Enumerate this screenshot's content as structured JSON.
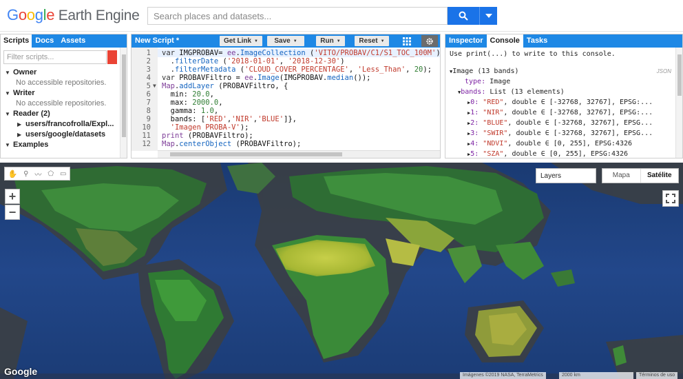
{
  "header": {
    "logo_parts": [
      "G",
      "o",
      "o",
      "g",
      "l",
      "e"
    ],
    "logo_rest": " Earth Engine",
    "search_placeholder": "Search places and datasets..."
  },
  "left_panel": {
    "tabs": [
      "Scripts",
      "Docs",
      "Assets"
    ],
    "filter_placeholder": "Filter scripts...",
    "tree": {
      "owner": "Owner",
      "owner_note": "No accessible repositories.",
      "writer": "Writer",
      "writer_note": "No accessible repositories.",
      "reader": "Reader (2)",
      "reader_items": [
        "users/francofrolla/Expl...",
        "users/google/datasets"
      ],
      "examples": "Examples"
    }
  },
  "editor": {
    "title": "New Script *",
    "buttons": {
      "get_link": "Get Link",
      "save": "Save",
      "run": "Run",
      "reset": "Reset"
    },
    "line_numbers": [
      "1",
      "2",
      "3",
      "4",
      "5",
      "6",
      "7",
      "8",
      "9",
      "10",
      "11",
      "12"
    ]
  },
  "right_panel": {
    "tabs": [
      "Inspector",
      "Console",
      "Tasks"
    ],
    "hint": "Use print(...) to write to this console.",
    "image_header": "Image (13 bands)",
    "json_label": "JSON",
    "type_key": "type:",
    "type_val": "Image",
    "bands_key": "bands:",
    "bands_val": "List (13 elements)",
    "bands": [
      {
        "idx": "0:",
        "name": "\"RED\"",
        "desc": ", double ∈ [-32768, 32767], EPSG:..."
      },
      {
        "idx": "1:",
        "name": "\"NIR\"",
        "desc": ", double ∈ [-32768, 32767], EPSG:..."
      },
      {
        "idx": "2:",
        "name": "\"BLUE\"",
        "desc": ", double ∈ [-32768, 32767], EPSG..."
      },
      {
        "idx": "3:",
        "name": "\"SWIR\"",
        "desc": ", double ∈ [-32768, 32767], EPSG..."
      },
      {
        "idx": "4:",
        "name": "\"NDVI\"",
        "desc": ", double ∈ [0, 255], EPSG:4326"
      },
      {
        "idx": "5:",
        "name": "\"SZA\"",
        "desc": ", double ∈ [0, 255], EPSG:4326"
      }
    ]
  },
  "map": {
    "zoom_in": "+",
    "zoom_out": "−",
    "layers": "Layers",
    "map_types": [
      "Mapa",
      "Satélite"
    ],
    "google_mark": "Google",
    "attribution": "Imágenes ©2019 NASA, TerraMetrics",
    "scale": "2000 km",
    "terms": "Términos de uso"
  },
  "colors": {
    "brand_blue": "#1e88e5",
    "search_blue": "#1a73e8",
    "ocean": "#1d3f78",
    "vegetation": "#3f9a3a",
    "desert": "#a8b83a"
  }
}
